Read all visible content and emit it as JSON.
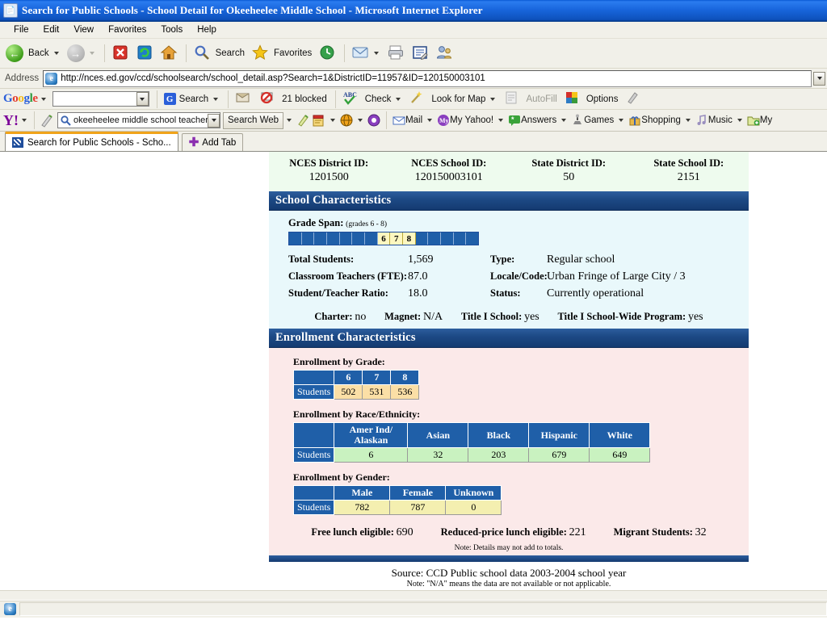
{
  "window": {
    "title": "Search for Public Schools - School Detail for Okeeheelee Middle School - Microsoft Internet Explorer",
    "icon": "ie-document-icon"
  },
  "menu": {
    "items": [
      "File",
      "Edit",
      "View",
      "Favorites",
      "Tools",
      "Help"
    ]
  },
  "toolbar": {
    "back_label": "Back",
    "forward_label": "",
    "stop_icon": "stop-icon",
    "refresh_icon": "refresh-icon",
    "home_icon": "home-icon",
    "search_label": "Search",
    "favorites_label": "Favorites",
    "history_icon": "history-icon",
    "mail_icon": "mail-icon",
    "print_icon": "print-icon",
    "edit_icon": "edit-page-icon",
    "messenger_icon": "messenger-icon"
  },
  "address": {
    "label": "Address",
    "url": "http://nces.ed.gov/ccd/schoolsearch/school_detail.asp?Search=1&DistrictID=11957&ID=120150003101"
  },
  "google_toolbar": {
    "logo": "Google",
    "search_value": "",
    "search_label": "Search",
    "blocked_label": "21 blocked",
    "check_label": "Check",
    "lookformap_label": "Look for Map",
    "autofill_label": "AutoFill",
    "options_label": "Options",
    "highlight_icon": "highlighter-icon"
  },
  "yahoo_toolbar": {
    "logo": "Y!",
    "search_value": "okeeheelee middle school teachers",
    "search_web_label": "Search Web",
    "mail_label": "Mail",
    "my_yahoo_label": "My Yahoo!",
    "answers_label": "Answers",
    "games_label": "Games",
    "shopping_label": "Shopping",
    "music_label": "Music",
    "more_label": "My",
    "pencil_icon": "pencil-icon",
    "notepad_icon": "notepad-icon",
    "globe_icon": "globe-icon",
    "antispy_icon": "antispy-icon"
  },
  "tabs": {
    "active_tab_label": "Search for Public Schools - Scho...",
    "add_tab_label": "Add Tab"
  },
  "page": {
    "ids": [
      {
        "label": "NCES District ID:",
        "value": "1201500"
      },
      {
        "label": "NCES School ID:",
        "value": "120150003101"
      },
      {
        "label": "State District ID:",
        "value": "50"
      },
      {
        "label": "State School ID:",
        "value": "2151"
      }
    ],
    "school_characteristics": {
      "heading": "School Characteristics",
      "grade_span_label": "Grade Span:",
      "grade_span_note": "(grades 6 - 8)",
      "grade_cells": [
        "",
        "",
        "",
        "",
        "",
        "",
        "",
        "6",
        "7",
        "8",
        "",
        "",
        "",
        "",
        ""
      ],
      "total_students_label": "Total Students:",
      "total_students_value": "1,569",
      "classroom_teachers_label": "Classroom Teachers (FTE):",
      "classroom_teachers_value": "87.0",
      "ratio_label": "Student/Teacher Ratio:",
      "ratio_value": "18.0",
      "type_label": "Type:",
      "type_value": "Regular school",
      "locale_label": "Locale/Code:",
      "locale_value": "Urban Fringe of Large City / 3",
      "status_label": "Status:",
      "status_value": "Currently operational",
      "charter_label": "Charter:",
      "charter_value": "no",
      "magnet_label": "Magnet:",
      "magnet_value": "N/A",
      "title1_label": "Title I School:",
      "title1_value": "yes",
      "title1_wide_label": "Title I School-Wide Program:",
      "title1_wide_value": "yes"
    },
    "enrollment_characteristics": {
      "heading": "Enrollment Characteristics",
      "by_grade": {
        "label": "Enrollment by Grade:",
        "row_header": "Students",
        "columns": [
          "6",
          "7",
          "8"
        ],
        "values": [
          "502",
          "531",
          "536"
        ]
      },
      "by_race": {
        "label": "Enrollment by Race/Ethnicity:",
        "row_header": "Students",
        "columns": [
          "Amer Ind/ Alaskan",
          "Asian",
          "Black",
          "Hispanic",
          "White"
        ],
        "values": [
          "6",
          "32",
          "203",
          "679",
          "649"
        ]
      },
      "by_gender": {
        "label": "Enrollment by Gender:",
        "row_header": "Students",
        "columns": [
          "Male",
          "Female",
          "Unknown"
        ],
        "values": [
          "782",
          "787",
          "0"
        ]
      },
      "free_lunch_label": "Free lunch eligible:",
      "free_lunch_value": "690",
      "reduced_lunch_label": "Reduced-price lunch eligible:",
      "reduced_lunch_value": "221",
      "migrant_label": "Migrant Students:",
      "migrant_value": "32",
      "note": "Note: Details may not add to totals."
    },
    "source_line": "Source: CCD Public school data 2003-2004 school year",
    "source_note": "Note: \"N/A\" means the data are not available or not applicable."
  },
  "statusbar": {
    "text": "",
    "icon": "ie-icon"
  },
  "colors": {
    "title_blue": "#1966dd",
    "band_blue": "#1d4a86",
    "table_header_blue": "#1f5fa8",
    "id_strip_green": "#eefbee",
    "school_body_cyan": "#e9f8fb",
    "enroll_body_pink": "#fbe9e9",
    "grade_highlight": "#fdf7c0",
    "grade_cell_value": "#fbdfa6",
    "race_cell_value": "#c9f2c0",
    "gender_cell_value": "#f4efb0",
    "tab_accent_orange": "#f0a31a"
  }
}
